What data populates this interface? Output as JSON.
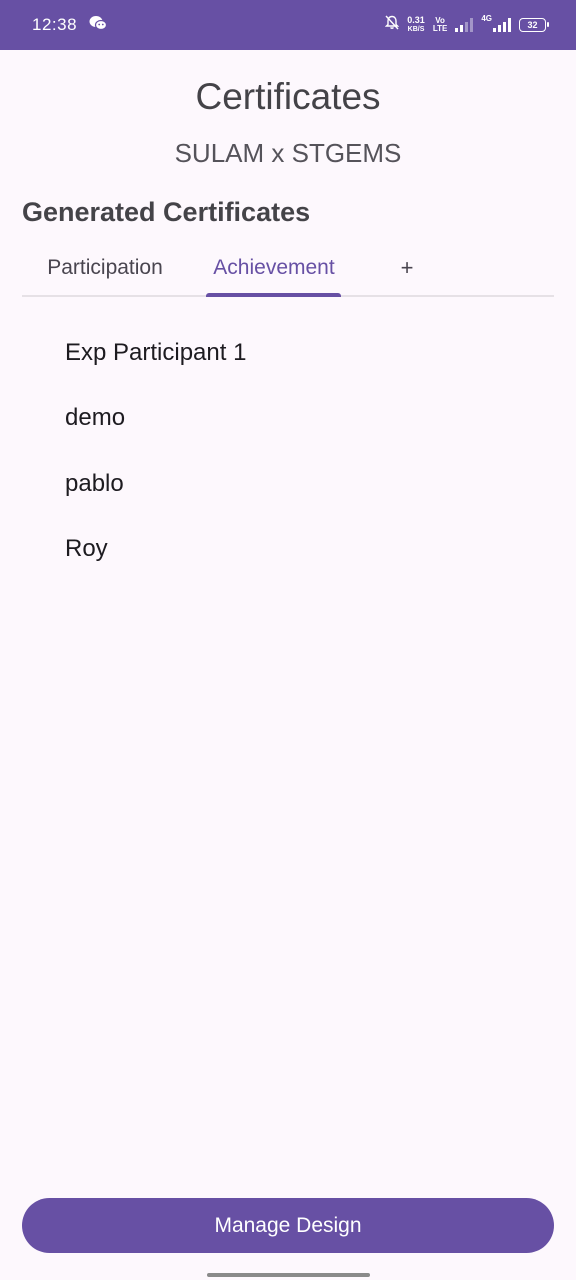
{
  "status_bar": {
    "time": "12:38",
    "net_speed_value": "0.31",
    "net_speed_unit": "KB/S",
    "volte_top": "Vo",
    "volte_bottom": "LTE",
    "network_type": "4G",
    "battery": "32",
    "icons": [
      "wechat-icon",
      "mute-bell-icon",
      "signal-icon",
      "signal-4g-icon",
      "battery-icon"
    ]
  },
  "header": {
    "title": "Certificates",
    "subtitle": "SULAM x STGEMS"
  },
  "section": {
    "heading": "Generated Certificates"
  },
  "tabs": [
    {
      "label": "Participation",
      "active": false
    },
    {
      "label": "Achievement",
      "active": true
    },
    {
      "label": "+",
      "active": false
    }
  ],
  "certificates": [
    "Exp Participant 1",
    "demo",
    "pablo",
    "Roy"
  ],
  "footer": {
    "button_label": "Manage Design"
  },
  "colors": {
    "primary": "#6750a4",
    "background": "#fdf8fd",
    "text": "#1d1b20"
  }
}
